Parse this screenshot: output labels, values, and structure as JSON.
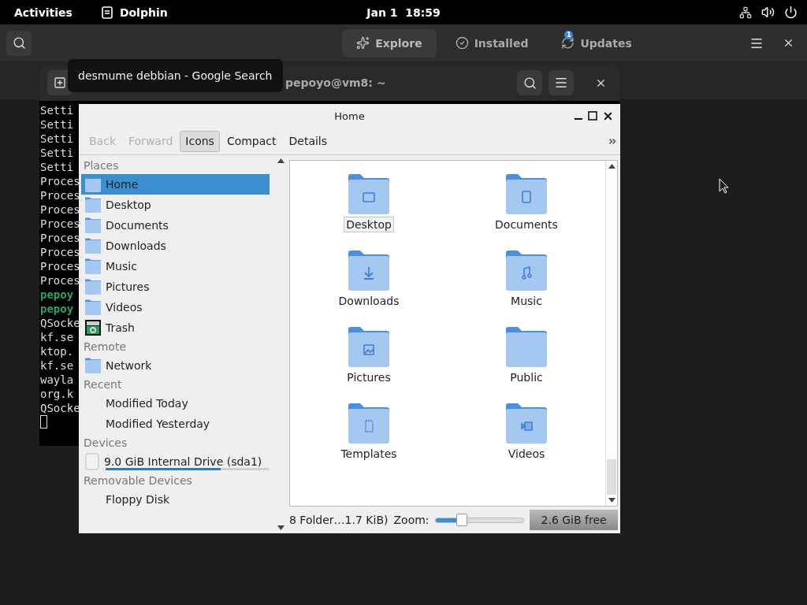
{
  "top_bar": {
    "activities": "Activities",
    "app": "Dolphin",
    "clock": "Jan 1  18:59"
  },
  "software_header": {
    "tabs": [
      {
        "label": "Explore",
        "selected": true,
        "kind": "explore"
      },
      {
        "label": "Installed",
        "selected": false,
        "kind": "installed"
      },
      {
        "label": "Updates",
        "selected": false,
        "kind": "updates",
        "badge": "1"
      }
    ]
  },
  "terminal": {
    "title": "pepoyo@vm8: ~",
    "lines": [
      {
        "text": "Setti",
        "kind": "plain"
      },
      {
        "text": "Setti",
        "kind": "plain"
      },
      {
        "text": "Setti",
        "kind": "plain"
      },
      {
        "text": "Setti",
        "kind": "plain"
      },
      {
        "text": "Setti",
        "kind": "plain"
      },
      {
        "text": "Proces",
        "kind": "plain"
      },
      {
        "text": "Proces",
        "kind": "plain"
      },
      {
        "text": "Proces",
        "kind": "plain"
      },
      {
        "text": "Proces",
        "kind": "plain"
      },
      {
        "text": "Proces",
        "kind": "plain"
      },
      {
        "text": "Proces",
        "kind": "plain"
      },
      {
        "text": "Proces",
        "kind": "plain"
      },
      {
        "text": "Proces",
        "kind": "plain"
      },
      {
        "text": "pepoy",
        "kind": "prompt"
      },
      {
        "text": "pepoy",
        "kind": "prompt"
      },
      {
        "text": "QSocke",
        "kind": "plain"
      },
      {
        "text": "kf.se",
        "kind": "plain"
      },
      {
        "text": "ktop.",
        "kind": "plain"
      },
      {
        "text": "kf.se",
        "kind": "plain"
      },
      {
        "text": "wayla",
        "kind": "plain"
      },
      {
        "text": "org.k",
        "kind": "plain"
      },
      {
        "text": "QSocke",
        "kind": "plain"
      }
    ]
  },
  "tooltip": "desmume debbian - Google Search",
  "dolphin": {
    "title": "Home",
    "toolbar": [
      {
        "label": "Back",
        "disabled": true,
        "selected": false
      },
      {
        "label": "Forward",
        "disabled": true,
        "selected": false
      },
      {
        "label": "Icons",
        "disabled": false,
        "selected": true
      },
      {
        "label": "Compact",
        "disabled": false,
        "selected": false
      },
      {
        "label": "Details",
        "disabled": false,
        "selected": false
      }
    ],
    "places": [
      {
        "heading": "Places",
        "items": [
          {
            "label": "Home",
            "kind": "folder",
            "selected": true
          },
          {
            "label": "Desktop",
            "kind": "folder",
            "selected": false
          },
          {
            "label": "Documents",
            "kind": "folder",
            "selected": false
          },
          {
            "label": "Downloads",
            "kind": "folder",
            "selected": false
          },
          {
            "label": "Music",
            "kind": "folder",
            "selected": false
          },
          {
            "label": "Pictures",
            "kind": "folder",
            "selected": false
          },
          {
            "label": "Videos",
            "kind": "folder",
            "selected": false
          },
          {
            "label": "Trash",
            "kind": "trash",
            "selected": false
          }
        ]
      },
      {
        "heading": "Remote",
        "items": [
          {
            "label": "Network",
            "kind": "folder",
            "selected": false
          }
        ]
      },
      {
        "heading": "Recent",
        "items": [
          {
            "label": "Modified Today",
            "kind": "plain",
            "selected": false
          },
          {
            "label": "Modified Yesterday",
            "kind": "plain",
            "selected": false
          }
        ]
      },
      {
        "heading": "Devices",
        "items": [
          {
            "label": "9.0 GiB Internal Drive (sda1)",
            "kind": "drive",
            "selected": false,
            "level": 0.7
          }
        ]
      },
      {
        "heading": "Removable Devices",
        "items": [
          {
            "label": "Floppy Disk",
            "kind": "plain",
            "selected": false
          }
        ]
      }
    ],
    "files": [
      {
        "name": "Desktop",
        "kind": "desktop",
        "selected": true
      },
      {
        "name": "Documents",
        "kind": "document",
        "selected": false
      },
      {
        "name": "Downloads",
        "kind": "download",
        "selected": false
      },
      {
        "name": "Music",
        "kind": "music",
        "selected": false
      },
      {
        "name": "Pictures",
        "kind": "picture",
        "selected": false
      },
      {
        "name": "Public",
        "kind": "plain",
        "selected": false
      },
      {
        "name": "Templates",
        "kind": "template",
        "selected": false
      },
      {
        "name": "Videos",
        "kind": "video",
        "selected": false
      }
    ],
    "status": "8 Folder…1.7 KiB)",
    "zoom_label": "Zoom:",
    "zoom": {
      "level": 0.27
    },
    "free_space": "2.6 GiB free"
  }
}
